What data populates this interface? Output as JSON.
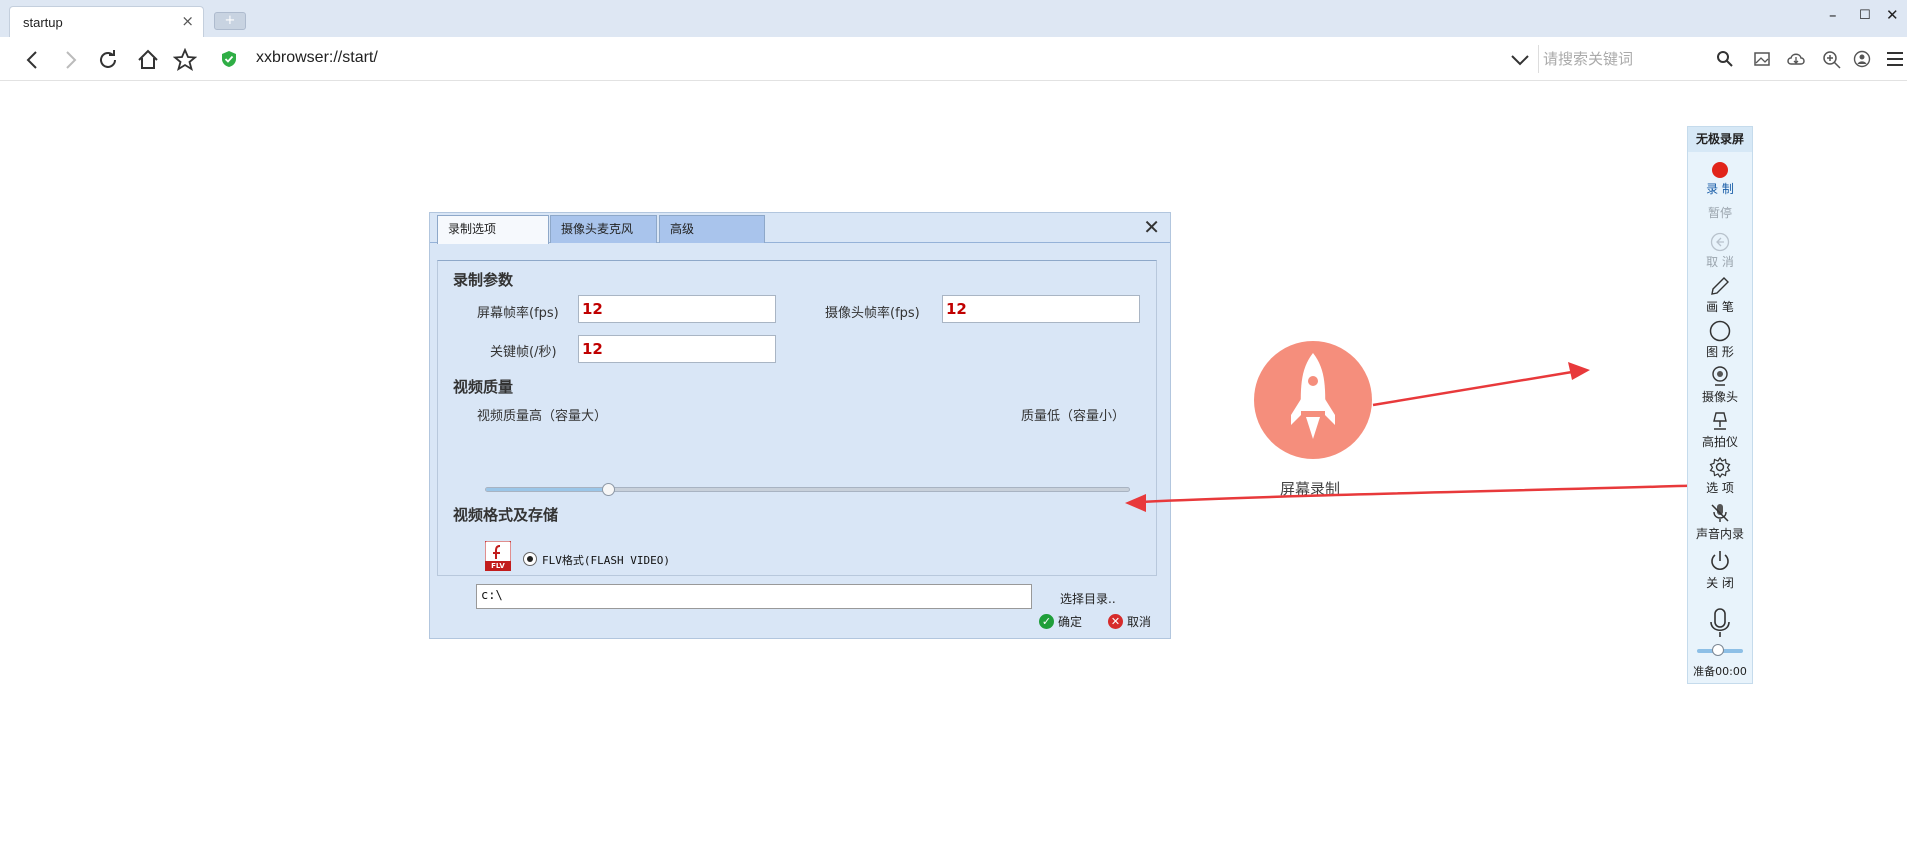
{
  "browser": {
    "tab_title": "startup",
    "tab_close": "×",
    "new_tab": "+",
    "window": {
      "minimize": "–",
      "maximize": "☐",
      "close": "✕"
    },
    "url": "xxbrowser://start/",
    "search_placeholder": "请搜索关键词"
  },
  "dialog": {
    "tabs": [
      "录制选项",
      "摄像头麦克风",
      "高级"
    ],
    "close_label": "✕",
    "record_params_title": "录制参数",
    "screen_fps_label": "屏幕帧率(fps)",
    "screen_fps_value": "12",
    "camera_fps_label": "摄像头帧率(fps)",
    "camera_fps_value": "12",
    "keyframe_label": "关键帧(/秒)",
    "keyframe_value": "12",
    "quality_title": "视频质量",
    "quality_high_label": "视频质量高（容量大）",
    "quality_low_label": "质量低（容量小）",
    "quality_level": 0.19,
    "format_title": "视频格式及存储",
    "flv_badge": "FLV",
    "format_option": "FLV格式(FLASH VIDEO)",
    "save_path": "c:\\",
    "choose_dir_label": "选择目录..",
    "ok_label": "确定",
    "cancel_label": "取消"
  },
  "center": {
    "label": "屏幕录制",
    "accent_color": "#f58e7c"
  },
  "arrow_color": "#e8393b",
  "recorder": {
    "title": "无极录屏",
    "items": [
      {
        "label": "录 制",
        "icon": "record-dot-icon",
        "state": "accent"
      },
      {
        "label": "暂停",
        "icon": "",
        "state": "disabled"
      },
      {
        "label": "取 消",
        "icon": "back-arrow-icon",
        "state": "disabled"
      },
      {
        "label": "画 笔",
        "icon": "pen-icon",
        "state": "normal"
      },
      {
        "label": "图 形",
        "icon": "circle-shape-icon",
        "state": "normal"
      },
      {
        "label": "摄像头",
        "icon": "webcam-icon",
        "state": "normal"
      },
      {
        "label": "高拍仪",
        "icon": "document-camera-icon",
        "state": "normal"
      },
      {
        "label": "选 项",
        "icon": "gear-icon",
        "state": "normal"
      },
      {
        "label": "声音内录",
        "icon": "mic-muted-icon",
        "state": "normal"
      },
      {
        "label": "关 闭",
        "icon": "power-icon",
        "state": "normal"
      }
    ],
    "mic_volume": 0.45,
    "status": "准备00:00"
  }
}
